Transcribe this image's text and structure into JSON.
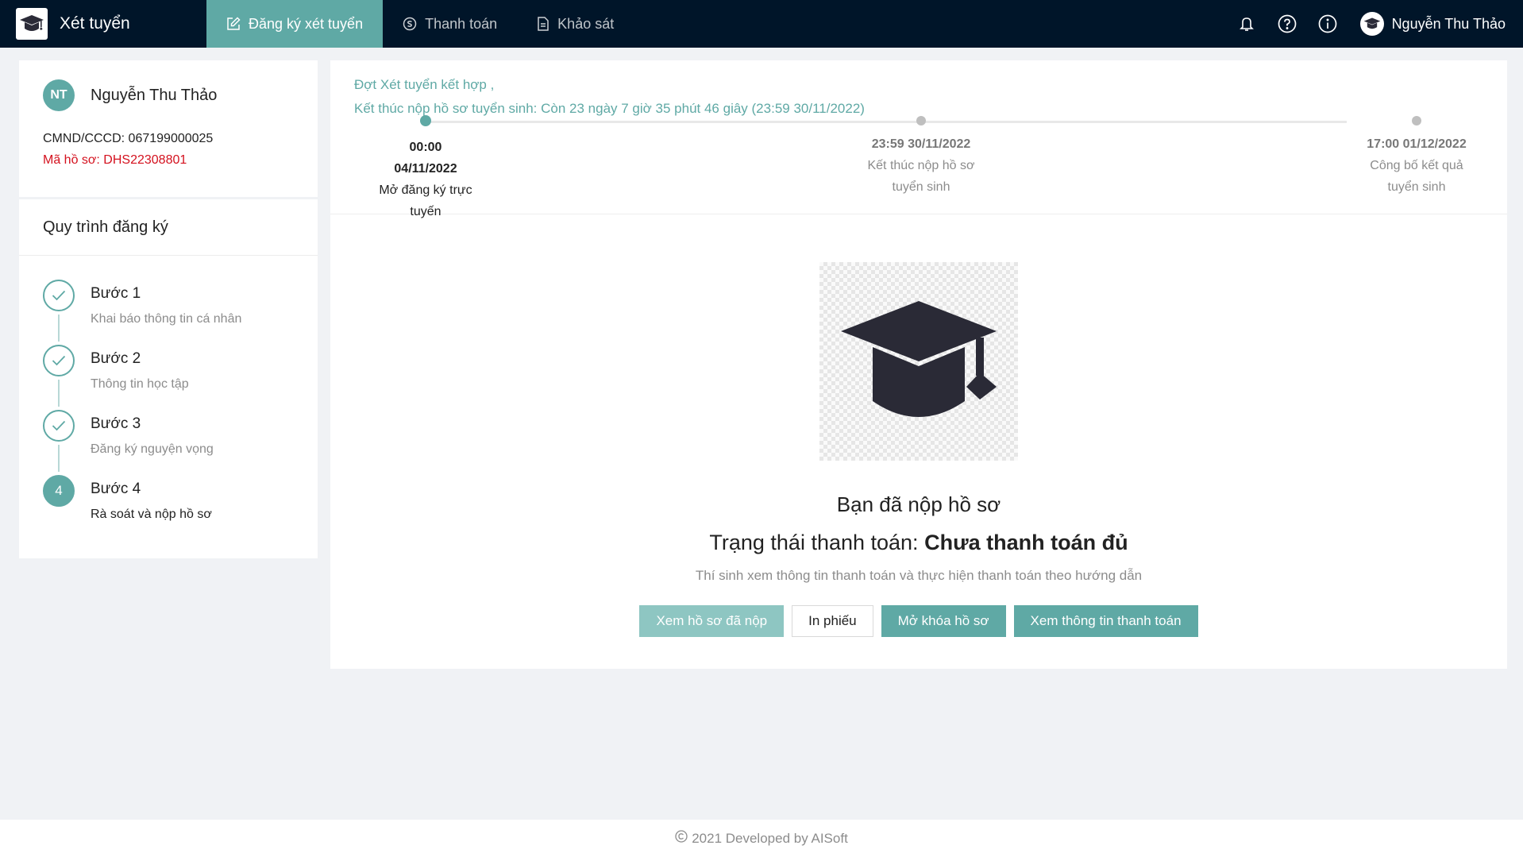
{
  "header": {
    "brand_title": "Xét tuyển",
    "nav": [
      {
        "label": "Đăng ký xét tuyển",
        "icon": "edit-icon",
        "active": true
      },
      {
        "label": "Thanh toán",
        "icon": "payment-icon",
        "active": false
      },
      {
        "label": "Khảo sát",
        "icon": "document-icon",
        "active": false
      }
    ],
    "user_name": "Nguyễn Thu Thảo"
  },
  "profile": {
    "initials": "NT",
    "name": "Nguyễn Thu Thảo",
    "id_line": "CMND/CCCD: 067199000025",
    "code_line": "Mã hồ sơ: DHS22308801"
  },
  "process": {
    "title": "Quy trình đăng ký",
    "steps": [
      {
        "title": "Bước 1",
        "desc": "Khai báo thông tin cá nhân",
        "done": true
      },
      {
        "title": "Bước 2",
        "desc": "Thông tin học tập",
        "done": true
      },
      {
        "title": "Bước 3",
        "desc": "Đăng ký nguyện vọng",
        "done": true
      },
      {
        "title": "Bước 4",
        "desc": "Rà soát và nộp hồ sơ",
        "done": false,
        "number": "4"
      }
    ]
  },
  "timeline": {
    "round": "Đợt Xét tuyển kết hợp ,",
    "deadline": "Kết thúc nộp hồ sơ tuyển sinh: Còn 23 ngày 7 giờ 35 phút 46 giây (23:59 30/11/2022)",
    "milestones": [
      {
        "date": "00:00 04/11/2022",
        "name": "Mở đăng ký trực tuyến"
      },
      {
        "date": "23:59 30/11/2022",
        "name": "Kết thúc nộp hồ sơ tuyển sinh"
      },
      {
        "date": "17:00 01/12/2022",
        "name": "Công bố kết quả tuyển sinh"
      }
    ]
  },
  "status": {
    "title": "Bạn đã nộp hồ sơ",
    "payment_prefix": "Trạng thái thanh toán:",
    "payment_value": "Chưa thanh toán đủ",
    "hint": "Thí sinh xem thông tin thanh toán và thực hiện thanh toán theo hướng dẫn",
    "buttons": {
      "view_submitted": "Xem hồ sơ đã nộp",
      "print": "In phiếu",
      "unlock": "Mở khóa hồ sơ",
      "view_payment": "Xem thông tin thanh toán"
    }
  },
  "footer": {
    "text": "2021 Developed by AISoft"
  },
  "colors": {
    "accent": "#5fa9a5",
    "header_bg": "#001529",
    "error": "#d4111e"
  }
}
